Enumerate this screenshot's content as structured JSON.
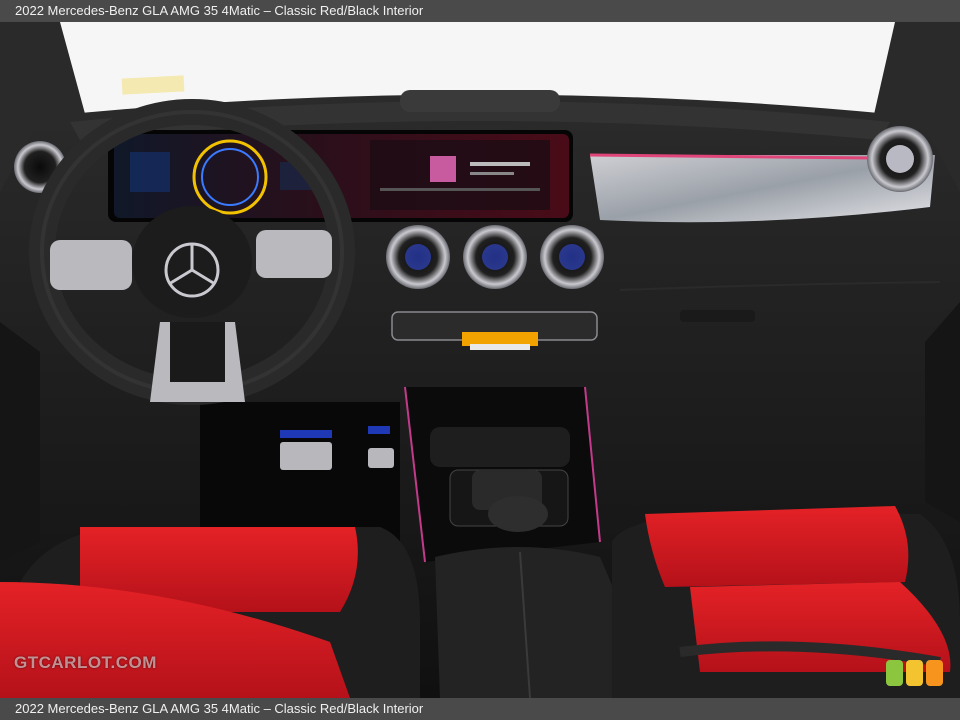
{
  "caption": {
    "top": "2022 Mercedes-Benz GLA AMG 35 4Matic – Classic Red/Black Interior",
    "bottom": "2022 Mercedes-Benz GLA AMG 35 4Matic – Classic Red/Black Interior"
  },
  "watermark": "GTCARLOT.COM",
  "colors": {
    "caption_bg": "#4a4a4a",
    "seat_red": "#d8191c",
    "dash_black": "#161616",
    "ambient_pink": "#e0457a",
    "ambient_blue": "#2a4dff",
    "logo_green": "#8cc63f",
    "logo_yellow": "#f4c430",
    "logo_orange": "#f7941d"
  },
  "icons": {
    "logo": "gtcarlot-squares-icon",
    "emblem": "mercedes-star-icon"
  }
}
